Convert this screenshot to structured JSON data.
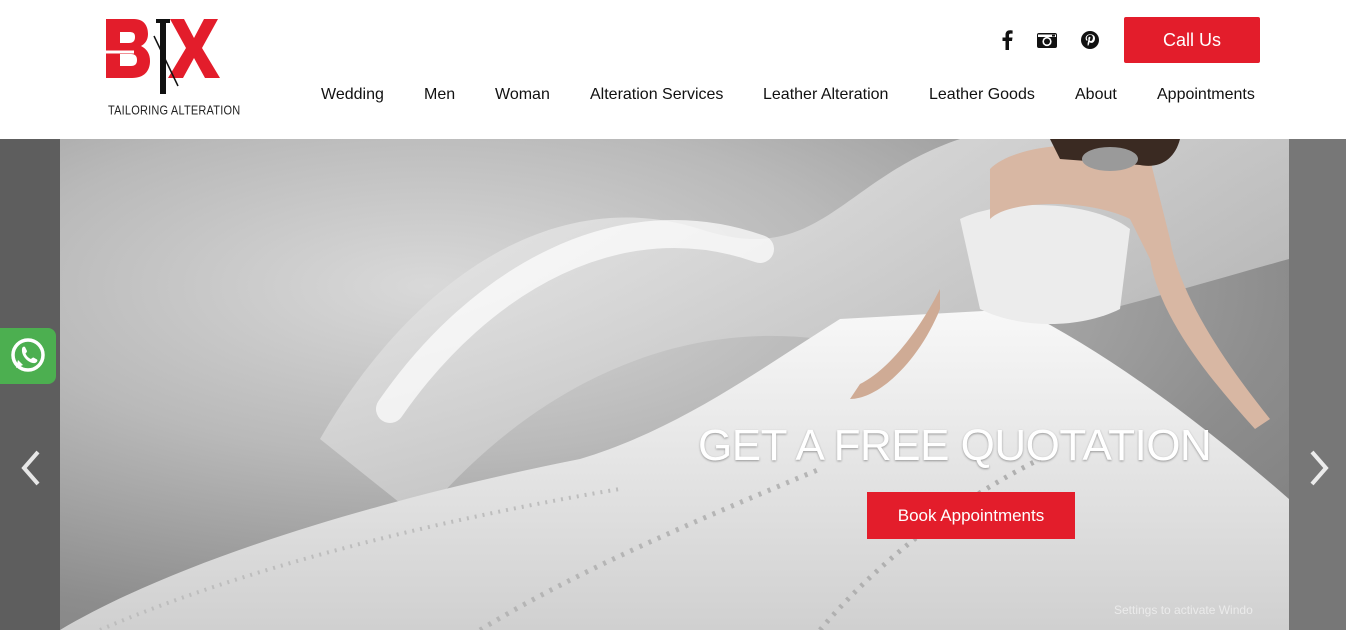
{
  "header": {
    "logo_tagline": "TAILORING ALTERATION",
    "call_button": "Call Us",
    "social": [
      {
        "icon": "facebook-icon"
      },
      {
        "icon": "instagram-icon"
      },
      {
        "icon": "pinterest-icon"
      }
    ],
    "nav": [
      {
        "label": "Wedding"
      },
      {
        "label": "Men"
      },
      {
        "label": "Woman"
      },
      {
        "label": "Alteration Services"
      },
      {
        "label": "Leather Alteration"
      },
      {
        "label": "Leather Goods"
      },
      {
        "label": "About"
      },
      {
        "label": "Appointments"
      }
    ]
  },
  "hero": {
    "heading": "GET A FREE QUOTATION",
    "button": "Book Appointments",
    "watermark": "Settings to activate Windo"
  },
  "colors": {
    "accent": "#e31d2b",
    "whatsapp": "#4caf50"
  }
}
